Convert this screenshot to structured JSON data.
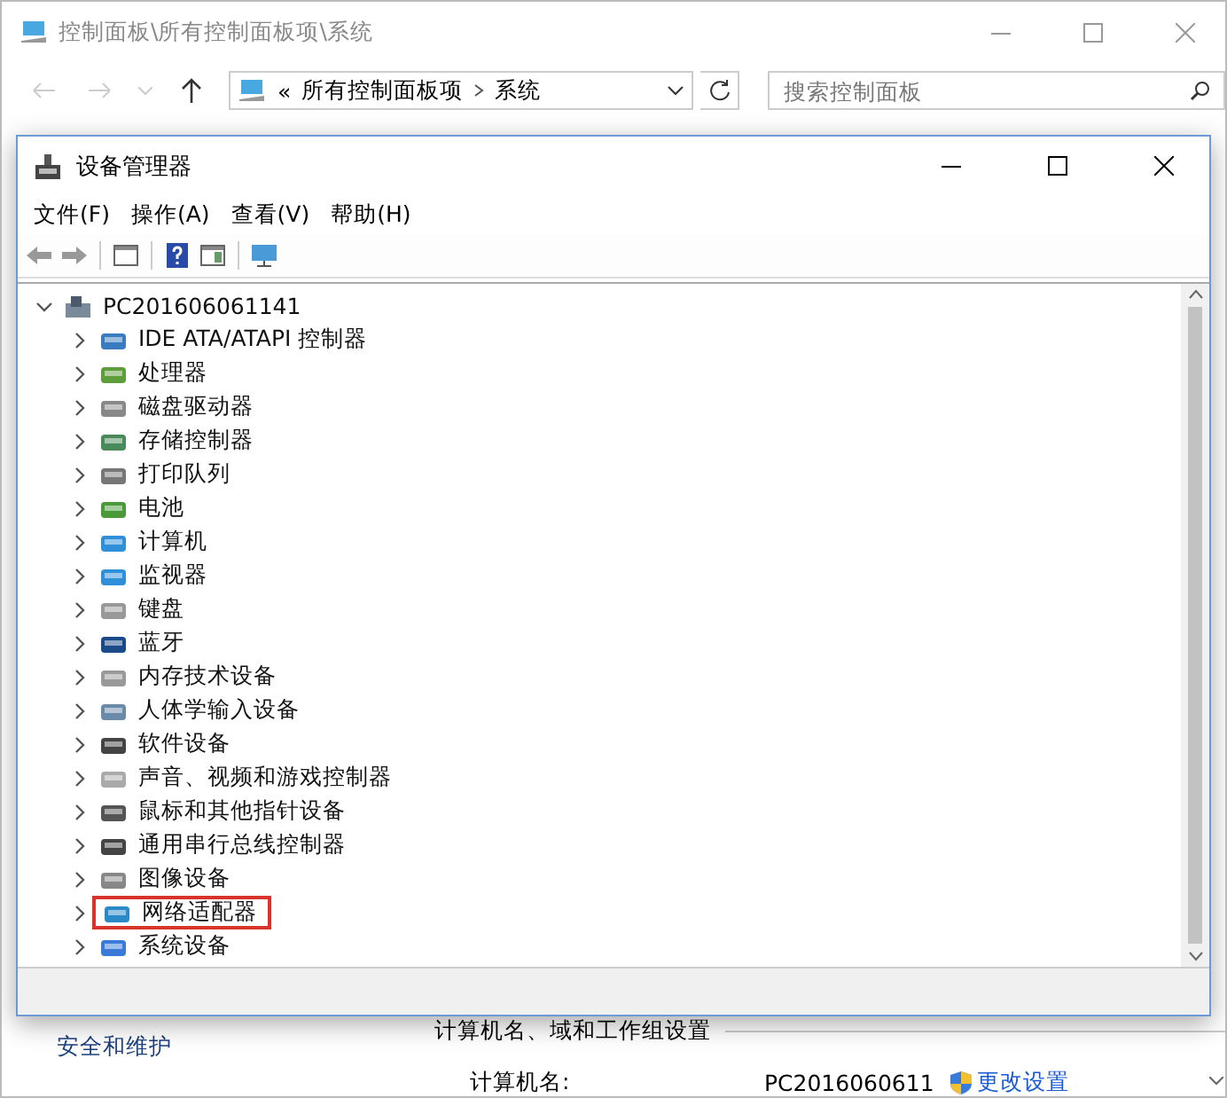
{
  "explorer": {
    "title": "控制面板\\所有控制面板项\\系统",
    "address": {
      "overflow": "«",
      "crumbs": [
        "所有控制面板项",
        "系统"
      ]
    },
    "search": {
      "placeholder": "搜索控制面板"
    },
    "content": {
      "sidebar_link": "安全和维护",
      "section_title": "计算机名、域和工作组设置",
      "fields": [
        {
          "label": "计算机名:",
          "value": "PC2016060611",
          "link": "更改设置"
        }
      ]
    }
  },
  "device_manager": {
    "title": "设备管理器",
    "menu": [
      "文件(F)",
      "操作(A)",
      "查看(V)",
      "帮助(H)"
    ],
    "tree": {
      "label": "PC201606061141",
      "expanded": true,
      "children": [
        {
          "label": "IDE ATA/ATAPI 控制器",
          "expanded": false,
          "highlighted": false
        },
        {
          "label": "处理器",
          "expanded": false,
          "highlighted": false
        },
        {
          "label": "磁盘驱动器",
          "expanded": false,
          "highlighted": false
        },
        {
          "label": "存储控制器",
          "expanded": false,
          "highlighted": false
        },
        {
          "label": "打印队列",
          "expanded": false,
          "highlighted": false
        },
        {
          "label": "电池",
          "expanded": false,
          "highlighted": false
        },
        {
          "label": "计算机",
          "expanded": false,
          "highlighted": false
        },
        {
          "label": "监视器",
          "expanded": false,
          "highlighted": false
        },
        {
          "label": "键盘",
          "expanded": false,
          "highlighted": false
        },
        {
          "label": "蓝牙",
          "expanded": false,
          "highlighted": false
        },
        {
          "label": "内存技术设备",
          "expanded": false,
          "highlighted": false
        },
        {
          "label": "人体学输入设备",
          "expanded": false,
          "highlighted": false
        },
        {
          "label": "软件设备",
          "expanded": false,
          "highlighted": false
        },
        {
          "label": "声音、视频和游戏控制器",
          "expanded": false,
          "highlighted": false
        },
        {
          "label": "鼠标和其他指针设备",
          "expanded": false,
          "highlighted": false
        },
        {
          "label": "通用串行总线控制器",
          "expanded": false,
          "highlighted": false
        },
        {
          "label": "图像设备",
          "expanded": false,
          "highlighted": false
        },
        {
          "label": "网络适配器",
          "expanded": false,
          "highlighted": true
        },
        {
          "label": "系统设备",
          "expanded": false,
          "highlighted": false
        }
      ]
    }
  }
}
